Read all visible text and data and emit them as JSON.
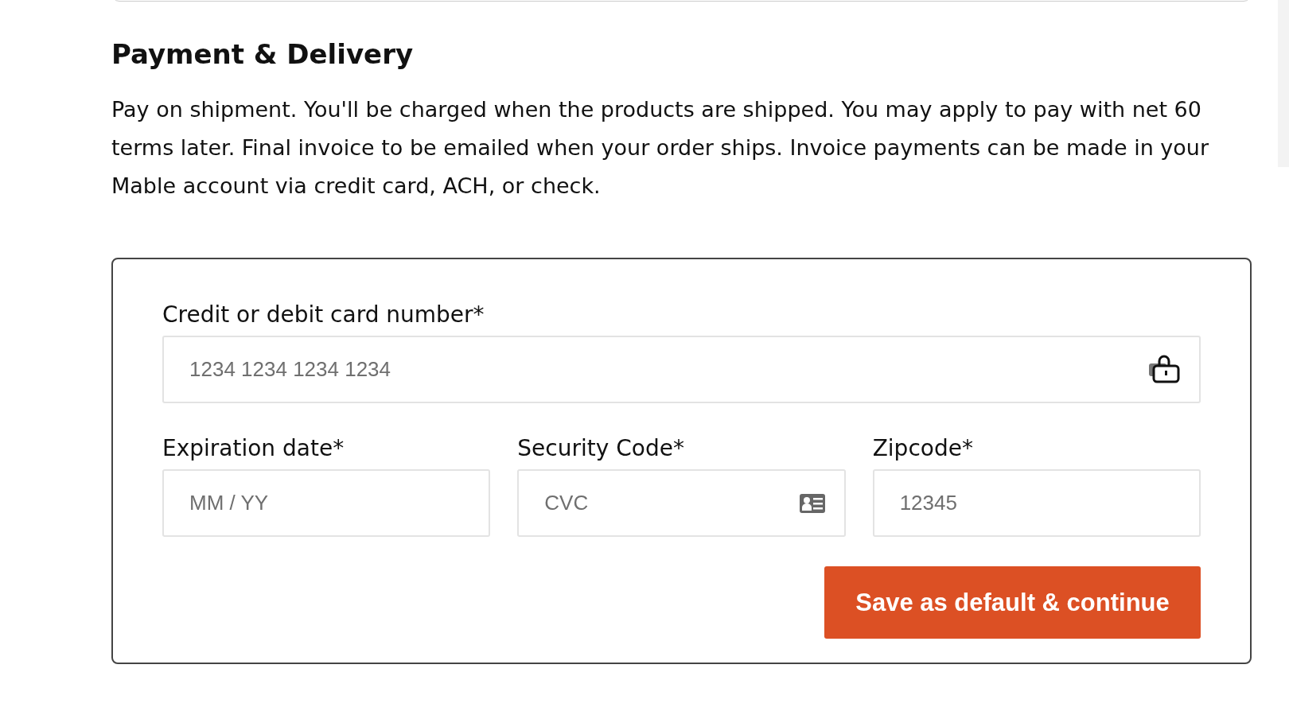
{
  "heading": "Payment & Delivery",
  "description": "Pay on shipment. You'll be charged when the products are shipped. You may apply to pay with net 60 terms later. Final invoice to be emailed when your order ships. Invoice payments can be made in your Mable account via credit card, ACH, or check.",
  "card_form": {
    "rows": [
      {
        "fields": [
          {
            "label": "Credit or debit card number*",
            "placeholder": "1234 1234 1234 1234",
            "kind": "card"
          }
        ]
      },
      {
        "fields": [
          {
            "label": "Expiration date*",
            "placeholder": "MM / YY",
            "kind": "plain"
          },
          {
            "label": "Security Code*",
            "placeholder": "CVC",
            "kind": "cvc"
          },
          {
            "label": "Zipcode*",
            "placeholder": "12345",
            "kind": "plain"
          }
        ]
      }
    ],
    "submit_button": "Save as default & continue"
  }
}
